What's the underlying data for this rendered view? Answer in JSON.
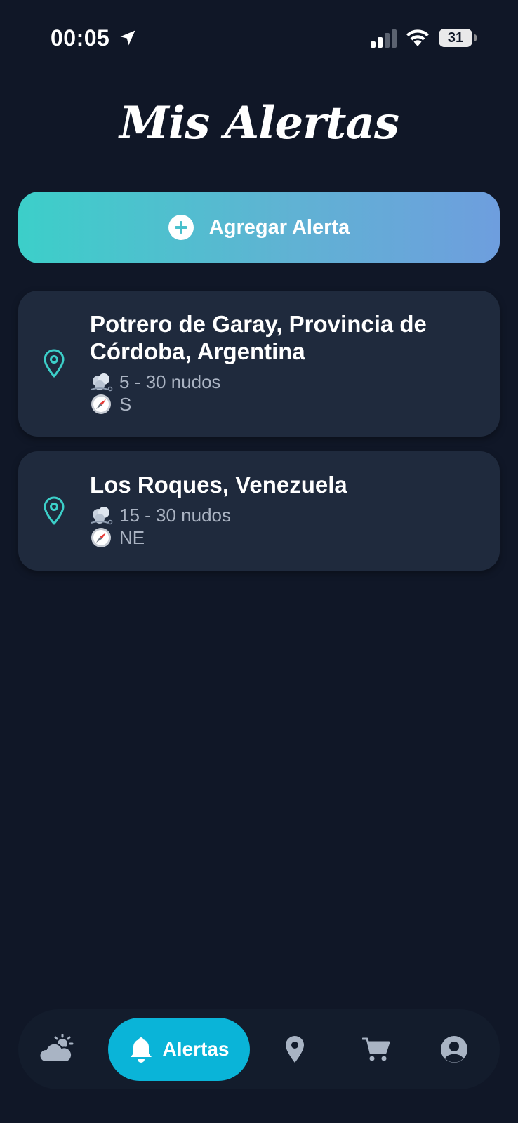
{
  "status_bar": {
    "time": "00:05",
    "battery": "31"
  },
  "page": {
    "title": "Mis Alertas"
  },
  "add_button": {
    "label": "Agregar Alerta",
    "gradient": [
      "#3ccfc9",
      "#6e9ede"
    ]
  },
  "alerts": [
    {
      "location": "Potrero de Garay, Provincia de Córdoba, Argentina",
      "wind_range": "5 - 30 nudos",
      "direction": "S",
      "icon": "location-pin-icon"
    },
    {
      "location": "Los Roques, Venezuela",
      "wind_range": "15 - 30 nudos",
      "direction": "NE",
      "icon": "location-pin-icon"
    }
  ],
  "nav": {
    "items": [
      {
        "icon": "weather-icon",
        "label": ""
      },
      {
        "icon": "bell-icon",
        "label": "Alertas"
      },
      {
        "icon": "map-pin-icon",
        "label": ""
      },
      {
        "icon": "cart-icon",
        "label": ""
      },
      {
        "icon": "profile-icon",
        "label": ""
      }
    ],
    "active_color": "#0ab4d8"
  },
  "colors": {
    "background": "#101727",
    "card": "#1f2a3d",
    "accent": "#3ccfc9"
  }
}
